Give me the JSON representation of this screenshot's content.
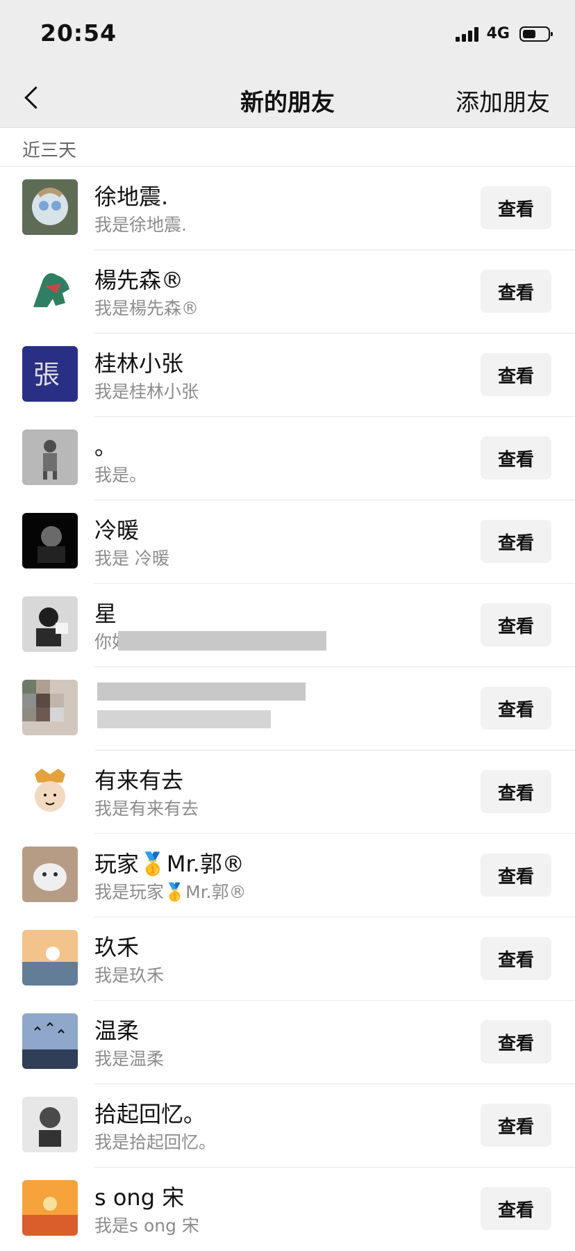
{
  "status_bar": {
    "time": "20:54",
    "network": "4G"
  },
  "nav": {
    "title": "新的朋友",
    "add_friend": "添加朋友"
  },
  "section": {
    "title": "近三天"
  },
  "friends": [
    {
      "name": "徐地震.",
      "message": "我是徐地震.",
      "action": "查看",
      "avatar_colors": [
        "#3d4a3a",
        "#9fb9c9",
        "#c9b48f"
      ]
    },
    {
      "name": "楊先森®",
      "message": "我是楊先森®",
      "action": "查看",
      "avatar_colors": [
        "#ffffff",
        "#2f7f62",
        "#5cb68d"
      ]
    },
    {
      "name": "桂林小张",
      "message": "我是桂林小张",
      "action": "查看",
      "avatar_colors": [
        "#2a2f86",
        "#3e47a5",
        "#cfcfcf"
      ]
    },
    {
      "name": "。",
      "message": "我是。",
      "action": "查看",
      "avatar_colors": [
        "#b8b8b8",
        "#4d4d4d",
        "#d8d8d8"
      ]
    },
    {
      "name": "冷暖",
      "message": "我是 冷暖",
      "action": "查看",
      "avatar_colors": [
        "#050505",
        "#3a3a3a",
        "#9d9d9d"
      ]
    },
    {
      "name": "星",
      "message": "你好",
      "action": "查看",
      "avatar_colors": [
        "#d8d8d8",
        "#222222",
        "#f1f1f1"
      ]
    },
    {
      "name": "",
      "message": "",
      "action": "查看",
      "avatar_colors": [
        "#8e8e8e",
        "#5a4a43",
        "#d2c7be"
      ]
    },
    {
      "name": "有来有去",
      "message": "我是有来有去",
      "action": "查看",
      "avatar_colors": [
        "#ffffff",
        "#e3a23b",
        "#e5c9a7"
      ]
    },
    {
      "name": "玩家🥇Mr.郭®",
      "message": "我是玩家🥇Mr.郭®",
      "action": "查看",
      "avatar_colors": [
        "#b79c85",
        "#efefef",
        "#8b8b8b"
      ]
    },
    {
      "name": "玖禾",
      "message": "我是玖禾",
      "action": "查看",
      "avatar_colors": [
        "#f2c38b",
        "#f3f3f3",
        "#627d97"
      ]
    },
    {
      "name": "温柔",
      "message": "我是温柔",
      "action": "查看",
      "avatar_colors": [
        "#8ea7ca",
        "#ffffff",
        "#2e3f57"
      ]
    },
    {
      "name": "拾起回忆。",
      "message": "我是拾起回忆。",
      "action": "查看",
      "avatar_colors": [
        "#e7e7e7",
        "#4a4a4a",
        "#bcbcbc"
      ]
    },
    {
      "name": "s ong  宋",
      "message": "我是s ong  宋",
      "action": "查看",
      "avatar_colors": [
        "#f6a33b",
        "#d95e2c",
        "#f8e19a"
      ]
    }
  ],
  "colors": {
    "header_bg": "#ededed",
    "row_bg": "#ffffff",
    "muted_text": "#8c8c8c",
    "button_bg": "#f2f2f2"
  }
}
